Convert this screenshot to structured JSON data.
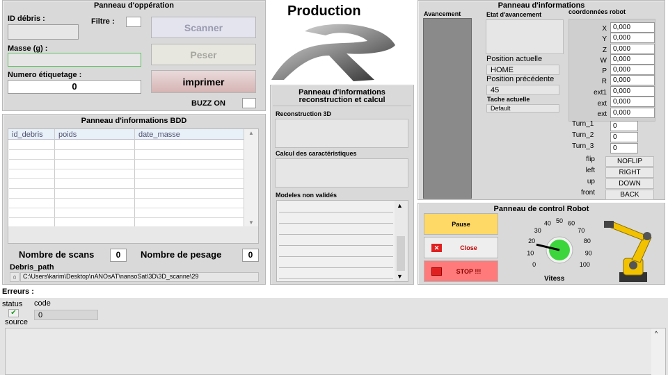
{
  "operation": {
    "title": "Panneau d'oppération",
    "id_label": "ID débris :",
    "filter_label": "Filtre :",
    "masse_label": "Masse (g) :",
    "etiquetage_label": "Numero étiquetage :",
    "etiquetage_value": "0",
    "buzz_label": "BUZZ ON",
    "scan_btn": "Scanner",
    "peser_btn": "Peser",
    "imprimer_btn": "imprimer"
  },
  "logo": {
    "title": "Production"
  },
  "bdd": {
    "title": "Panneau d'informations BDD",
    "columns": [
      "id_debris",
      "poids",
      "date_masse"
    ],
    "scans_label": "Nombre de scans",
    "scans_value": "0",
    "pesage_label": "Nombre de pesage",
    "pesage_value": "0",
    "path_label": "Debris_path",
    "path_value": "C:\\Users\\karim\\Desktop\\nANOsAT\\nansoSat\\3D\\3D_scanne\\29"
  },
  "reconstruction": {
    "title_line1": "Panneau d'informations",
    "title_line2": "reconstruction et calcul",
    "recon_label": "Reconstruction 3D",
    "calc_label": "Calcul des caractéristiques",
    "models_label": "Modeles non validés"
  },
  "info": {
    "title": "Panneau d'informations",
    "avancement_label": "Avancement",
    "etat_label": "Etat d'avancement",
    "coords_label": "coordonnées robot",
    "pos_actuelle_label": "Position actuelle",
    "pos_actuelle_value": "HOME",
    "pos_prec_label": "Position précédente",
    "pos_prec_value": "45",
    "tache_label": "Tache actuelle",
    "tache_value": "Default",
    "coords": [
      {
        "label": "X",
        "value": "0,000"
      },
      {
        "label": "Y",
        "value": "0,000"
      },
      {
        "label": "Z",
        "value": "0,000"
      },
      {
        "label": "W",
        "value": "0,000"
      },
      {
        "label": "P",
        "value": "0,000"
      },
      {
        "label": "R",
        "value": "0,000"
      },
      {
        "label": "ext1",
        "value": "0,000"
      },
      {
        "label": "ext",
        "value": "0,000"
      },
      {
        "label": "ext",
        "value": "0,000"
      }
    ],
    "turns": [
      {
        "label": "Turn_1",
        "value": "0"
      },
      {
        "label": "Turn_2",
        "value": "0"
      },
      {
        "label": "Turn_3",
        "value": "0"
      }
    ],
    "configs": [
      {
        "label": "flip",
        "value": "NOFLIP"
      },
      {
        "label": "left",
        "value": "RIGHT"
      },
      {
        "label": "up",
        "value": "DOWN"
      },
      {
        "label": "front",
        "value": "BACK"
      }
    ]
  },
  "robot": {
    "title": "Panneau de control Robot",
    "pause_btn": "Pause",
    "close_btn": "Close",
    "stop_btn": "STOP !!!",
    "vitess_label": "Vitess",
    "gauge_ticks": [
      "0",
      "10",
      "20",
      "30",
      "40",
      "50",
      "60",
      "70",
      "80",
      "90",
      "100"
    ],
    "speed_value": 18
  },
  "errors": {
    "title": "Erreurs :",
    "status_label": "status",
    "code_label": "code",
    "code_value": "0",
    "source_label": "source"
  },
  "colors": {
    "pause": "#ffd966",
    "stop": "#ff7a7a",
    "close_red": "#e02020",
    "knob": "#3cd63c",
    "robot": "#f2c200"
  }
}
